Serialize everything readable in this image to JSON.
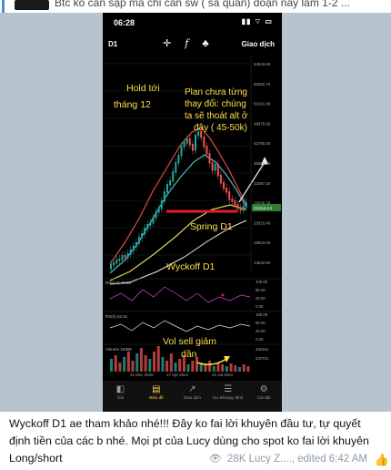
{
  "reply": {
    "preview_text": "Btc ko cần sập mà chỉ cần sw ( sá quần) đoạn này làm 1-2 ..."
  },
  "phone": {
    "status_time": "06:28",
    "status_icons": "▮▮ ⌔ ▭",
    "timeframe": "D1",
    "tool_icons": [
      "crosshair-icon",
      "function-icon",
      "indicator-icon"
    ],
    "trade_label": "Giao dịch",
    "price_ticks": [
      "63543.60",
      "58352.70",
      "53161.80",
      "48970.90",
      "43780.00",
      "38589.10",
      "33397.20",
      "28206.30",
      "23015.40",
      "18823.50",
      "13632.60"
    ],
    "current_price": "31514.14",
    "annotations": {
      "hold": "Hold tới tháng 12",
      "plan_lines": [
        "Plan chưa từng",
        "thay đổi: chúng",
        "ta sẽ thoát alt ở",
        "đây ( 45-50k)"
      ],
      "spring": "Spring D1",
      "wyckoff": "Wyckoff D1",
      "vol": "Vol sell giảm dần"
    },
    "rsi_label": "RSI(14) 48.35",
    "rsi_ticks": [
      "100.00",
      "80.00",
      "20.00",
      "0.00"
    ],
    "rsi2_label": "RS(6) 52.91",
    "rsi2_ticks": [
      "100.00",
      "80.00",
      "20.00",
      "0.00"
    ],
    "volume_label": "Volume 16369",
    "volume_ticks": [
      "440161",
      "220701"
    ],
    "date_ticks": [
      "21 Dec 2020",
      "17 Apr 2021",
      "22 Jul 2021"
    ],
    "nav": [
      {
        "label": "Giá",
        "icon": "price-icon"
      },
      {
        "label": "Biểu đồ",
        "icon": "chart-icon"
      },
      {
        "label": "Giao dịch",
        "icon": "trade-icon"
      },
      {
        "label": "Ưu tiên/quy định",
        "icon": "list-icon"
      },
      {
        "label": "Cài đặt",
        "icon": "settings-icon"
      }
    ],
    "nav_active": 1
  },
  "caption": {
    "text": "Wyckoff D1 ae tham khảo nhé!!! Đây ko fai lời khuyên đầu tư, tự quyết định tiền của các b nhé. Mọi pt của Lucy dùng cho spot ko fai lời khuyên Long/short"
  },
  "meta": {
    "views": "28K",
    "author": "Lucy Z....",
    "edited": "edited 6:42 AM"
  },
  "colors": {
    "annotation": "#ffde4a",
    "price_tag": "#2e7d32",
    "support": "#e02020",
    "up_candle": "#26a69a",
    "down_candle": "#ef5350"
  }
}
